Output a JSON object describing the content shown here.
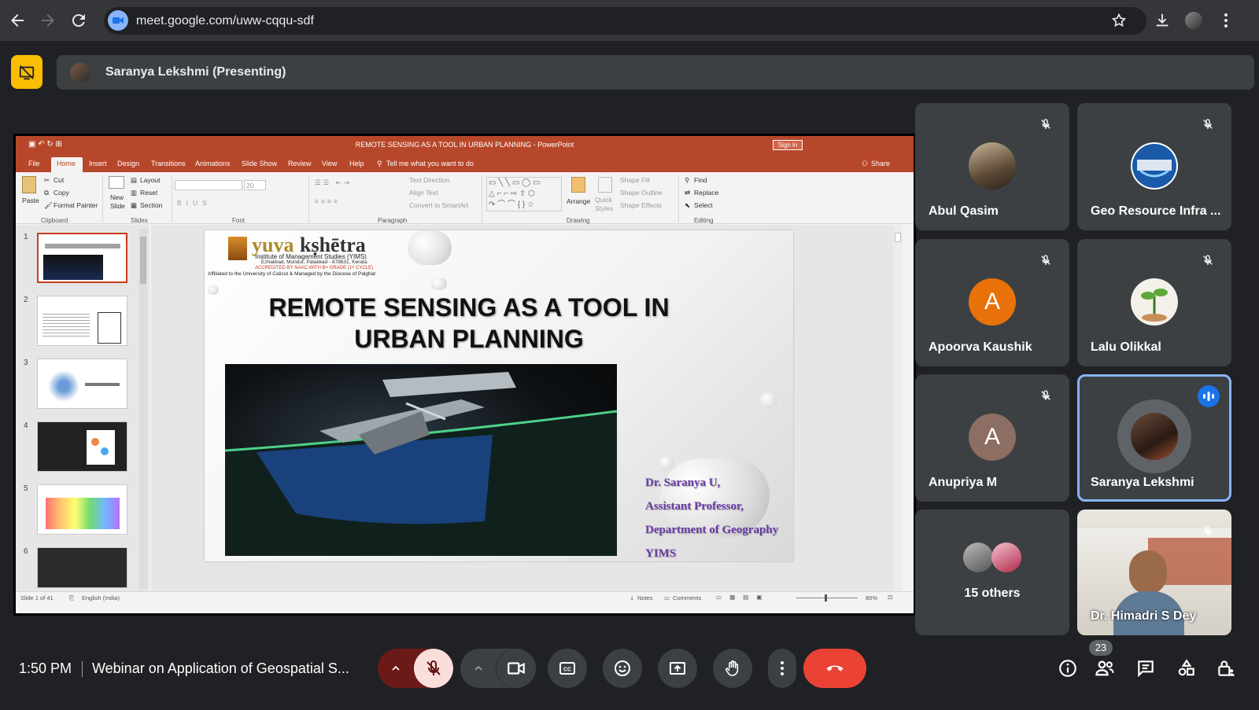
{
  "browser": {
    "url": "meet.google.com/uww-cqqu-sdf"
  },
  "presenting": {
    "label": "Saranya Lekshmi (Presenting)"
  },
  "powerpoint": {
    "window_title": "REMOTE SENSING AS A TOOL IN URBAN PLANNING  -  PowerPoint",
    "sign_in": "Sign in",
    "tabs": [
      "File",
      "Home",
      "Insert",
      "Design",
      "Transitions",
      "Animations",
      "Slide Show",
      "Review",
      "View",
      "Help"
    ],
    "tell_me": "Tell me what you want to do",
    "share": "Share",
    "ribbon": {
      "paste": "Paste",
      "cut": "Cut",
      "copy": "Copy",
      "format_painter": "Format Painter",
      "clipboard": "Clipboard",
      "new_slide": "New Slide",
      "layout": "Layout",
      "reset": "Reset",
      "section": "Section",
      "slides": "Slides",
      "font_size": "20",
      "font": "Font",
      "text_direction": "Text Direction",
      "align_text": "Align Text",
      "convert_smartart": "Convert to SmartArt",
      "paragraph": "Paragraph",
      "arrange": "Arrange",
      "quick_styles": "Quick Styles",
      "shape_fill": "Shape Fill",
      "shape_outline": "Shape Outline",
      "shape_effects": "Shape Effects",
      "drawing": "Drawing",
      "find": "Find",
      "replace": "Replace",
      "select": "Select",
      "editing": "Editing"
    },
    "thumbnails": [
      "1",
      "2",
      "3",
      "4",
      "5",
      "6"
    ],
    "slide": {
      "logo_word_a": "yuva",
      "logo_word_b": "kṣhētra",
      "institute": "Institute of Management Studies (YIMS)",
      "address": "Ezhakkad, Mundur, Palakkad - 678631, Kerala.",
      "accreditation": "ACCREDITED BY NAAC WITH B+ GRADE (1ˢᵗ CYCLE)",
      "affiliation": "Affiliated to the University of Calicut & Managed by the Diocese of Palghat",
      "title_line1": "REMOTE SENSING AS A TOOL IN",
      "title_line2": "URBAN PLANNING",
      "author": "Dr. Saranya U,",
      "position": "Assistant Professor,",
      "department": "Department of Geography",
      "org": "YIMS"
    },
    "status": {
      "slide_count": "Slide 1 of 41",
      "language": "English (India)",
      "notes": "Notes",
      "comments": "Comments",
      "zoom": "80%"
    }
  },
  "participants": [
    {
      "name": "Abul Qasim",
      "muted": true
    },
    {
      "name": "Geo Resource Infra ...",
      "muted": true
    },
    {
      "name": "Apoorva Kaushik",
      "initial": "A",
      "color": "#e8710a",
      "muted": true
    },
    {
      "name": "Lalu Olikkal",
      "muted": true
    },
    {
      "name": "Anupriya M",
      "initial": "A",
      "color": "#8d6e63",
      "muted": true
    },
    {
      "name": "Saranya Lekshmi",
      "speaking": true
    },
    {
      "name": "15 others"
    },
    {
      "name": "Dr. Himadri S Dey",
      "muted": true
    }
  ],
  "bottom_bar": {
    "time": "1:50 PM",
    "meeting_title": "Webinar on Application of Geospatial S...",
    "people_count": "23"
  },
  "colors": {
    "accent_blue": "#8ab4f8",
    "end_call_red": "#ea4335",
    "mic_off_bg": "#f9dedc",
    "powerpoint_red": "#b7472a",
    "present_yellow": "#fbbc04"
  }
}
